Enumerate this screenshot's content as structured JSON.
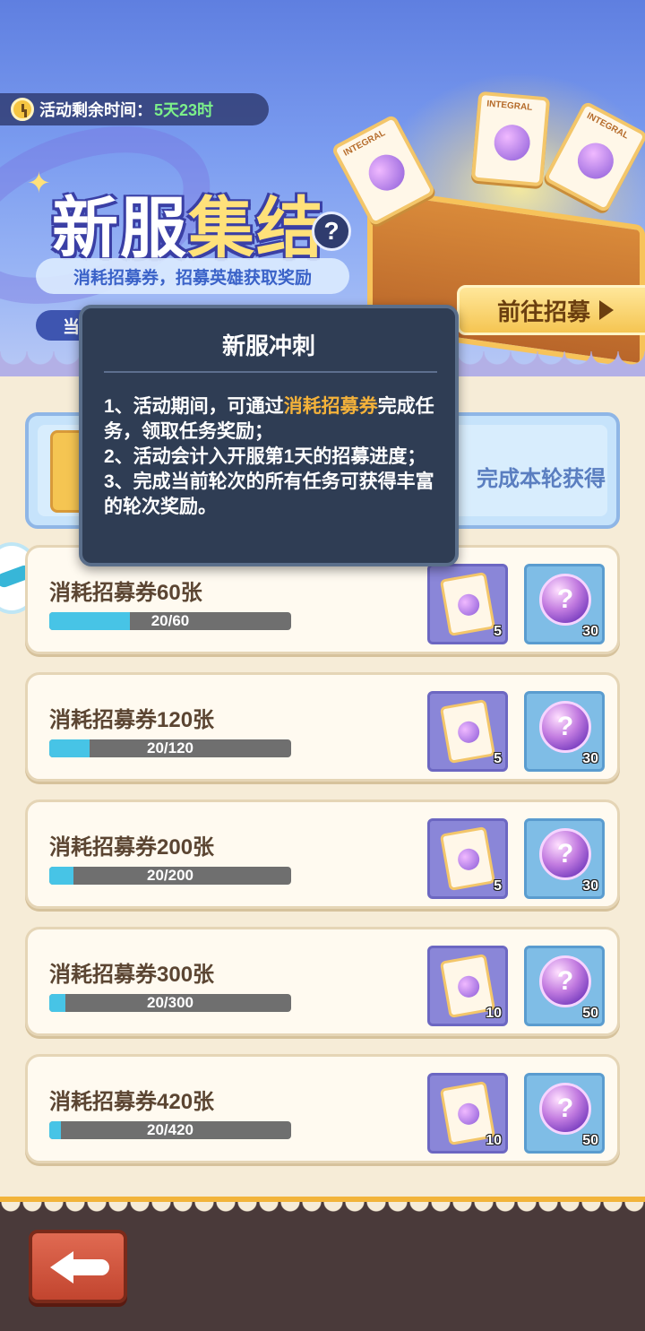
{
  "banner": {
    "timer_label": "活动剩余时间：",
    "timer_value": "5天23时",
    "title_part1": "新服",
    "title_part2": "集结",
    "help_symbol": "?",
    "subtitle": "消耗招募券，招募英雄获取奖励",
    "round_label": "当前轮次",
    "recruit_button": "前往招募",
    "ticket_tag": "INTEGRAL"
  },
  "summary": {
    "note": "完成本轮获得"
  },
  "tooltip": {
    "title": "新服冲刺",
    "line1_pre": "1、活动期间，可通过",
    "line1_highlight": "消耗招募券",
    "line1_post": "完成任务，领取任务奖励；",
    "line2": "2、活动会计入开服第1天的招募进度；",
    "line3": "3、完成当前轮次的所有任务可获得丰富的轮次奖励。"
  },
  "tasks": [
    {
      "name": "消耗招募券60张",
      "progress_text": "20/60",
      "progress": 0.3333,
      "ticket_qty": "5",
      "orb_qty": "30"
    },
    {
      "name": "消耗招募券120张",
      "progress_text": "20/120",
      "progress": 0.1667,
      "ticket_qty": "5",
      "orb_qty": "30"
    },
    {
      "name": "消耗招募券200张",
      "progress_text": "20/200",
      "progress": 0.1,
      "ticket_qty": "5",
      "orb_qty": "30"
    },
    {
      "name": "消耗招募券300张",
      "progress_text": "20/300",
      "progress": 0.0667,
      "ticket_qty": "10",
      "orb_qty": "50"
    },
    {
      "name": "消耗招募券420张",
      "progress_text": "20/420",
      "progress": 0.0476,
      "ticket_qty": "10",
      "orb_qty": "50"
    }
  ],
  "icons": {
    "clock": "clock-icon",
    "help": "help-icon",
    "ticket": "recruit-ticket-icon",
    "orb": "mystery-orb-icon",
    "back": "back-arrow-icon"
  },
  "colors": {
    "accent": "#f4b23a",
    "progress": "#47c4e6",
    "timer_value": "#7cf08a"
  }
}
